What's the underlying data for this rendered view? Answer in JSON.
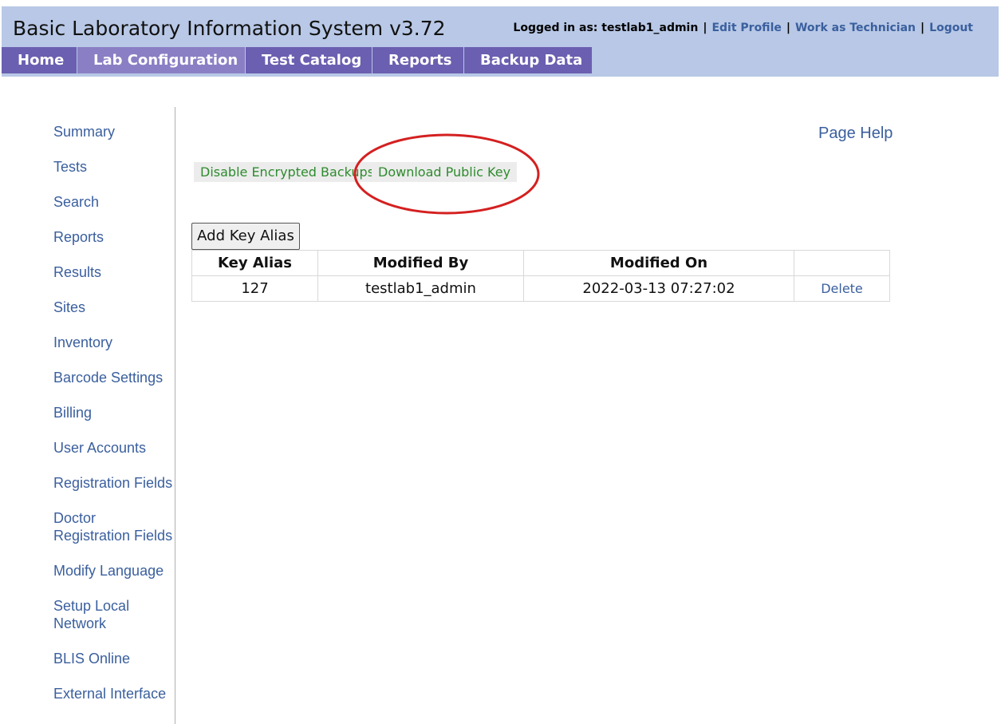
{
  "header": {
    "title": "Basic Laboratory Information System v3.72",
    "logged_in_label": "Logged in as: testlab1_admin",
    "links": {
      "edit_profile": "Edit Profile",
      "work_as_technician": "Work as Technician",
      "logout": "Logout"
    },
    "separator": "|"
  },
  "nav": {
    "items": [
      {
        "label": "Home"
      },
      {
        "label": "Lab Configuration",
        "active": true
      },
      {
        "label": "Test Catalog"
      },
      {
        "label": "Reports"
      },
      {
        "label": "Backup Data"
      }
    ]
  },
  "sidebar": {
    "items": [
      {
        "label": "Summary"
      },
      {
        "label": "Tests"
      },
      {
        "label": "Search"
      },
      {
        "label": "Reports"
      },
      {
        "label": "Results"
      },
      {
        "label": "Sites"
      },
      {
        "label": "Inventory"
      },
      {
        "label": "Barcode Settings"
      },
      {
        "label": "Billing"
      },
      {
        "label": "User Accounts"
      },
      {
        "label": "Registration Fields"
      },
      {
        "label": "Doctor Registration Fields"
      },
      {
        "label": "Modify Language"
      },
      {
        "label": "Setup Local Network"
      },
      {
        "label": "BLIS Online"
      },
      {
        "label": "External Interface"
      }
    ]
  },
  "main": {
    "page_help": "Page Help",
    "actions": {
      "disable_encrypted_backups": "Disable Encrypted Backups",
      "download_public_key": "Download Public Key"
    },
    "add_key_alias_button": "Add Key Alias",
    "table": {
      "columns": [
        "Key Alias",
        "Modified By",
        "Modified On",
        ""
      ],
      "rows": [
        {
          "key_alias": "127",
          "modified_by": "testlab1_admin",
          "modified_on": "2022-03-13 07:27:02",
          "action": "Delete"
        }
      ]
    }
  },
  "colors": {
    "header_bg": "#b8c8e6",
    "nav_bg": "#6a5fb0",
    "nav_active_bg": "#8a7fc4",
    "link": "#3a5f9e",
    "action_link": "#2e8b2e",
    "annotation": "#d42020"
  }
}
